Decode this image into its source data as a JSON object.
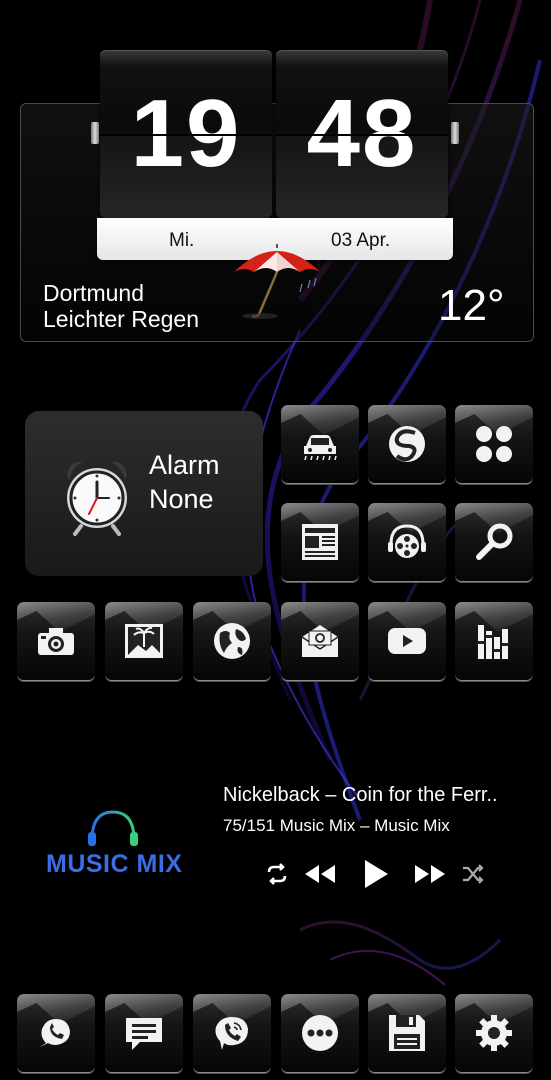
{
  "clock": {
    "hours": "19",
    "minutes": "48",
    "day": "Mi.",
    "date": "03 Apr."
  },
  "weather": {
    "city": "Dortmund",
    "condition": "Leichter Regen",
    "temperature": "12°",
    "icon": "umbrella-rain-icon"
  },
  "alarm": {
    "title": "Alarm",
    "value": "None"
  },
  "apps": [
    {
      "icon": "car-wash-icon"
    },
    {
      "icon": "swiftkey-icon"
    },
    {
      "icon": "four-dots-icon"
    },
    {
      "icon": "newspaper-icon"
    },
    {
      "icon": "film-headphones-icon"
    },
    {
      "icon": "wrench-search-icon"
    },
    {
      "icon": "camera-icon"
    },
    {
      "icon": "gallery-icon"
    },
    {
      "icon": "globe-icon"
    },
    {
      "icon": "email-icon"
    },
    {
      "icon": "youtube-icon"
    },
    {
      "icon": "equalizer-icon"
    }
  ],
  "music": {
    "logo_text": "MUSIC MIX",
    "track": "Nickelback – Coin for the Ferr..",
    "queue": "75/151 Music Mix – Music Mix",
    "accent": "#3b6de6"
  },
  "dock": [
    {
      "icon": "whatsapp-icon"
    },
    {
      "icon": "messages-icon"
    },
    {
      "icon": "viber-icon"
    },
    {
      "icon": "app-drawer-icon"
    },
    {
      "icon": "save-floppy-icon"
    },
    {
      "icon": "settings-gear-icon"
    }
  ]
}
